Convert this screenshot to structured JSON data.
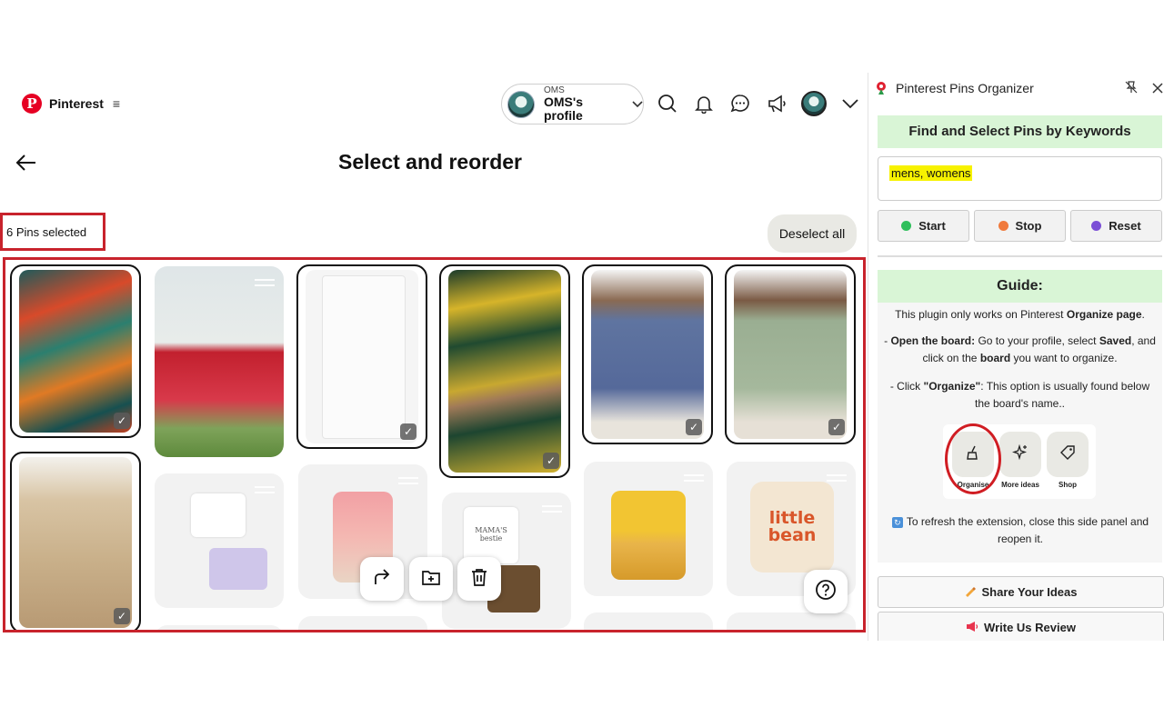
{
  "header": {
    "brand": "Pinterest",
    "menu_glyph": "≡",
    "profile_account": "OMS",
    "profile_name": "OMS's profile"
  },
  "page": {
    "title": "Select and reorder",
    "selected_count_text": "6 Pins selected",
    "deselect_label": "Deselect all"
  },
  "pins": [
    {
      "desc": "tropical print sleeveless dress",
      "selected": true
    },
    {
      "desc": "red floral sundress with straw hat",
      "selected": false
    },
    {
      "desc": "white cargo shorts",
      "selected": true
    },
    {
      "desc": "yellow leaf print shirt and shorts set",
      "selected": true
    },
    {
      "desc": "blue short sleeve button shirt",
      "selected": true
    },
    {
      "desc": "sage palm leaf print shirt",
      "selected": true
    },
    {
      "desc": "beige linen shirt and shorts set",
      "selected": true
    },
    {
      "desc": "white tee with bow and lavender shorts",
      "selected": false
    },
    {
      "desc": "pink floral baby romper with headband",
      "selected": false
    },
    {
      "desc": "Mama's bestie baby outfit",
      "selected": false,
      "print": "MAMA'S\nbestie"
    },
    {
      "desc": "yellow sunflower baby dress",
      "selected": false
    },
    {
      "desc": "little bean baby onesie",
      "selected": false,
      "print": "little bean"
    }
  ],
  "actions": {
    "move_icon": "share-arrow",
    "add_icon": "folder-plus",
    "delete_icon": "trash",
    "help_icon": "question"
  },
  "extension": {
    "title": "Pinterest Pins Organizer",
    "find_heading": "Find and Select Pins by Keywords",
    "keywords_value": "mens, womens",
    "start_label": "Start",
    "stop_label": "Stop",
    "reset_label": "Reset",
    "colors": {
      "start": "#2fbf5b",
      "stop": "#f07a3c",
      "reset": "#7b4fd6",
      "accent_green": "#d9f5d6",
      "highlight": "#f7f200",
      "selection_red": "#c8232c"
    },
    "guide": {
      "heading": "Guide:",
      "line1_a": "This plugin only works on Pinterest ",
      "line1_b": "Organize page",
      "line1_c": ".",
      "line2_a": "- ",
      "line2_b": "Open the board:",
      "line2_c": " Go to your profile, select ",
      "line2_d": "Saved",
      "line2_e": ", and click on the ",
      "line2_f": "board",
      "line2_g": " you want to organize.",
      "line3_a": "- Click ",
      "line3_b": "\"Organize\"",
      "line3_c": ": This option is usually found below the board's name..",
      "tab1": "Organise",
      "tab2": "More ideas",
      "tab3": "Shop",
      "refresh_text": "To refresh the extension, close this side panel and reopen it."
    },
    "share_label": "Share Your Ideas",
    "review_label": "Write Us Review"
  }
}
